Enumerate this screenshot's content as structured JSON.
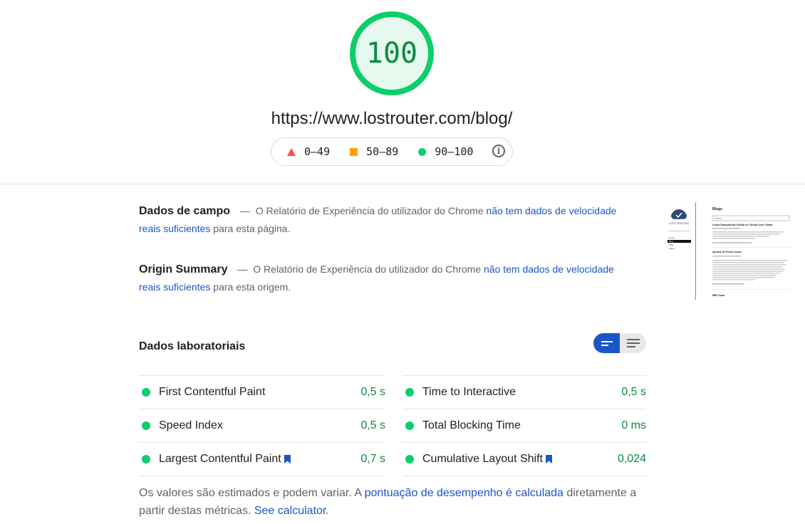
{
  "report": {
    "score": "100",
    "url": "https://www.lostrouter.com/blog/",
    "colors": {
      "pass": "#0cce6b",
      "average": "#ffa400",
      "fail": "#ff4e42",
      "link": "#1a56c8"
    }
  },
  "legend": {
    "fail": "0–49",
    "average": "50–89",
    "pass": "90–100"
  },
  "field_data": {
    "title": "Dados de campo",
    "dash": "—",
    "text_before": "O Relatório de Experiência do utilizador do Chrome",
    "link": "não tem dados de velocidade reais suficientes",
    "text_after": "para esta página."
  },
  "origin_summary": {
    "title": "Origin Summary",
    "dash": "—",
    "text_before": "O Relatório de Experiência do utilizador do Chrome",
    "link": "não tem dados de velocidade reais suficientes",
    "text_after": "para esta origem."
  },
  "thumbnail": {
    "logo_text": "LOST ROUTER",
    "heading": "Blogs",
    "search_placeholder": "Search",
    "nav": [
      "Home",
      "Blog",
      "Tags",
      "About"
    ],
    "posts": [
      "Lendo Repositórios Github no VScode Sem Clonar",
      "Ajustes de Preços Azure",
      "IBM Cloud"
    ]
  },
  "lab_data": {
    "title": "Dados laboratoriais",
    "metrics_left": [
      {
        "name": "First Contentful Paint",
        "value": "0,5 s",
        "bookmark": false
      },
      {
        "name": "Speed Index",
        "value": "0,5 s",
        "bookmark": false
      },
      {
        "name": "Largest Contentful Paint",
        "value": "0,7 s",
        "bookmark": true
      }
    ],
    "metrics_right": [
      {
        "name": "Time to Interactive",
        "value": "0,5 s",
        "bookmark": false
      },
      {
        "name": "Total Blocking Time",
        "value": "0 ms",
        "bookmark": false
      },
      {
        "name": "Cumulative Layout Shift",
        "value": "0,024",
        "bookmark": true
      }
    ]
  },
  "note": {
    "text_before": "Os valores são estimados e podem variar. A",
    "link1": "pontuação de desempenho é calculada",
    "text_mid": "diretamente a partir destas métricas.",
    "link2": "See calculator."
  }
}
